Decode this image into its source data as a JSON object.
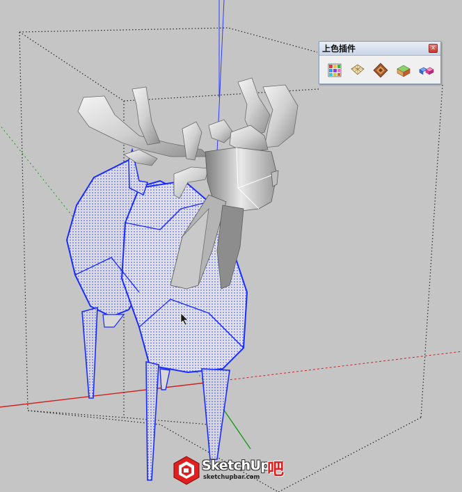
{
  "toolbar": {
    "title": "上色插件",
    "close_label": "x",
    "buttons": [
      {
        "name": "paint-palette-tool",
        "icon": "color-grid-icon"
      },
      {
        "name": "uv-grid-tool",
        "icon": "uv-map-icon"
      },
      {
        "name": "texture-tool",
        "icon": "texture-tile-icon"
      },
      {
        "name": "box-paint-tool",
        "icon": "box-paint-icon"
      },
      {
        "name": "material-swap-tool",
        "icon": "material-swap-icon"
      }
    ]
  },
  "watermark": {
    "brand_text": "SketchUp",
    "suffix_text": "吧",
    "url_text": "sketchupbar.com"
  },
  "colors": {
    "background": "#c5c5c5",
    "selection_blue": "#1a2bff",
    "axis_red": "#d02020",
    "axis_green": "#1a9a1a",
    "axis_blue": "#2b3cff",
    "brand_red": "#e02020"
  }
}
